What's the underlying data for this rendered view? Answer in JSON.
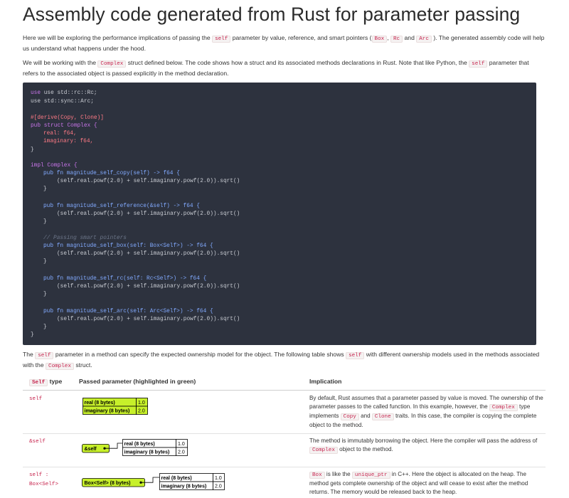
{
  "title": "Assembly code generated from Rust for parameter passing",
  "intro": {
    "p1_a": "Here we will be exploring the performance implications of passing the",
    "p1_code1": "self",
    "p1_b": "parameter by value, reference, and smart pointers (",
    "p1_code2": "Box",
    "p1_c": ",",
    "p1_code3": "Rc",
    "p1_d": "and",
    "p1_code4": "Arc",
    "p1_e": "). The generated assembly code will help us understand what happens under the hood.",
    "p2_a": "We will be working with the",
    "p2_code1": "Complex",
    "p2_b": "struct defined below. The code shows how a struct and its associated methods declarations in Rust. Note that like Python, the",
    "p2_code2": "self",
    "p2_c": "parameter that refers to the associated object is passed explicitly in the method declaration."
  },
  "code": {
    "use_rc": "use std::rc::Rc;",
    "use_arc": "use std::sync::Arc;",
    "attr": "#[derive(Copy, Clone)]",
    "struct_decl": "pub struct Complex {",
    "field_real": "real: f64,",
    "field_imag": "imaginary: f64,",
    "close": "}",
    "impl_decl": "impl Complex {",
    "fn_copy": "pub fn magnitude_self_copy(self) -> f64 {",
    "fn_ref": "pub fn magnitude_self_reference(&self) -> f64 {",
    "comment": "// Passing smart pointers",
    "fn_box": "pub fn magnitude_self_box(self: Box<Self>) -> f64 {",
    "fn_rc": "pub fn magnitude_self_rc(self: Rc<Self>) -> f64 {",
    "fn_arc": "pub fn magnitude_self_arc(self: Arc<Self>) -> f64 {",
    "body": "(self.real.powf(2.0) + self.imaginary.powf(2.0)).sqrt()"
  },
  "after": {
    "a": "The",
    "code1": "self",
    "b": "parameter in a method can specify the expected ownership model for the object. The following table shows",
    "code2": "self",
    "c": "with different ownership models used in the methods associated with the",
    "code3": "Complex",
    "d": "struct."
  },
  "table": {
    "headers": {
      "type_code": "Self",
      "type_text": "type",
      "passed": "Passed parameter (highlighted in green)",
      "implication": "Implication"
    },
    "rows": [
      {
        "type": "self",
        "diagram": {
          "field1": "real (8 bytes)",
          "val1": "1.0",
          "field2": "imaginary (8 bytes)",
          "val2": "2.0"
        },
        "imp_a": "By default, Rust assumes that a parameter passed by value is moved. The ownership of the parameter passes to the called function. In this example, however, the",
        "imp_code1": "Complex",
        "imp_b": "type implements",
        "imp_code2": "Copy",
        "imp_c": "and",
        "imp_code3": "Clone",
        "imp_d": "traits. In this case, the compiler is copying the complete object to the method."
      },
      {
        "type": "&self",
        "diagram": {
          "ptr": "&self",
          "field1": "real (8 bytes)",
          "val1": "1.0",
          "field2": "imaginary (8 bytes)",
          "val2": "2.0"
        },
        "imp_a": "The method is immutably borrowing the object. Here the compiler will pass the address of",
        "imp_code1": "Complex",
        "imp_b": "object to the method."
      },
      {
        "type_line1": "self :",
        "type_line2": "Box<Self>",
        "diagram": {
          "ptr": "Box<Self> (8 bytes)",
          "field1": "real (8 bytes)",
          "val1": "1.0",
          "field2": "imaginary (8 bytes)",
          "val2": "2.0"
        },
        "imp_code1": "Box",
        "imp_a": "is like the",
        "imp_code2": "unique_ptr",
        "imp_b": "in C++. Here the object is allocated on the heap. The method gets complete ownership of the object and will cease to exist after the method returns. The memory would be released back to the heap."
      }
    ]
  },
  "colors": {
    "code_bg": "#2d323e",
    "highlight_green": "#c7f02a",
    "inline_code": "#c7254e"
  }
}
